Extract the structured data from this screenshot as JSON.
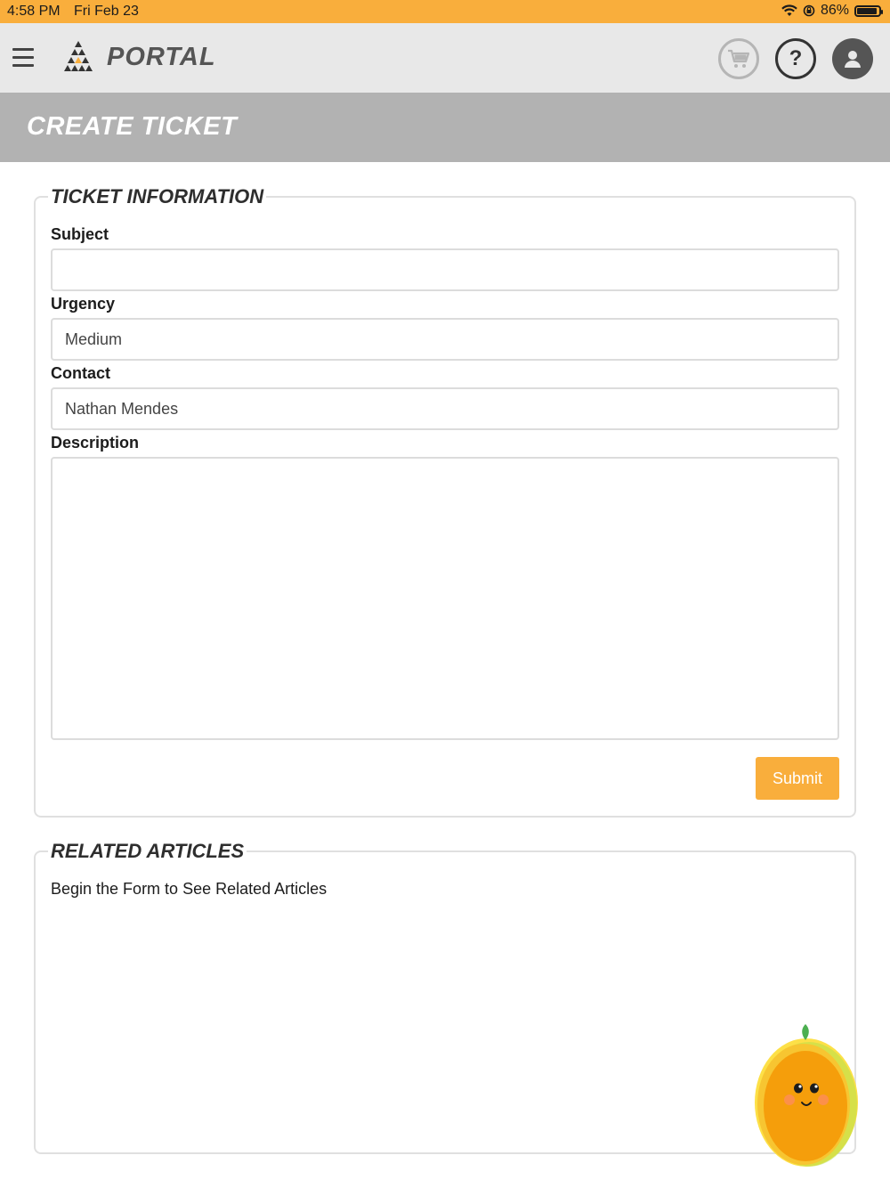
{
  "status_bar": {
    "time": "4:58 PM",
    "date": "Fri Feb 23",
    "battery": "86%",
    "battery_level": 0.86
  },
  "header": {
    "brand": "PORTAL",
    "icons": {
      "menu": "hamburger-menu-icon",
      "logo": "portal-logo",
      "cart": "cart-icon",
      "help": "help-icon",
      "profile": "user-icon"
    },
    "help_glyph": "?"
  },
  "page": {
    "title": "CREATE TICKET"
  },
  "ticket_form": {
    "legend": "TICKET INFORMATION",
    "subject": {
      "label": "Subject",
      "value": ""
    },
    "urgency": {
      "label": "Urgency",
      "value": "Medium"
    },
    "contact": {
      "label": "Contact",
      "value": "Nathan Mendes"
    },
    "description": {
      "label": "Description",
      "value": ""
    },
    "submit_label": "Submit"
  },
  "related_articles": {
    "legend": "RELATED ARTICLES",
    "message": "Begin the Form to See Related Articles"
  },
  "colors": {
    "accent": "#f9ae3c",
    "header_bg": "#e8e8e8",
    "banner_bg": "#b2b2b2"
  }
}
